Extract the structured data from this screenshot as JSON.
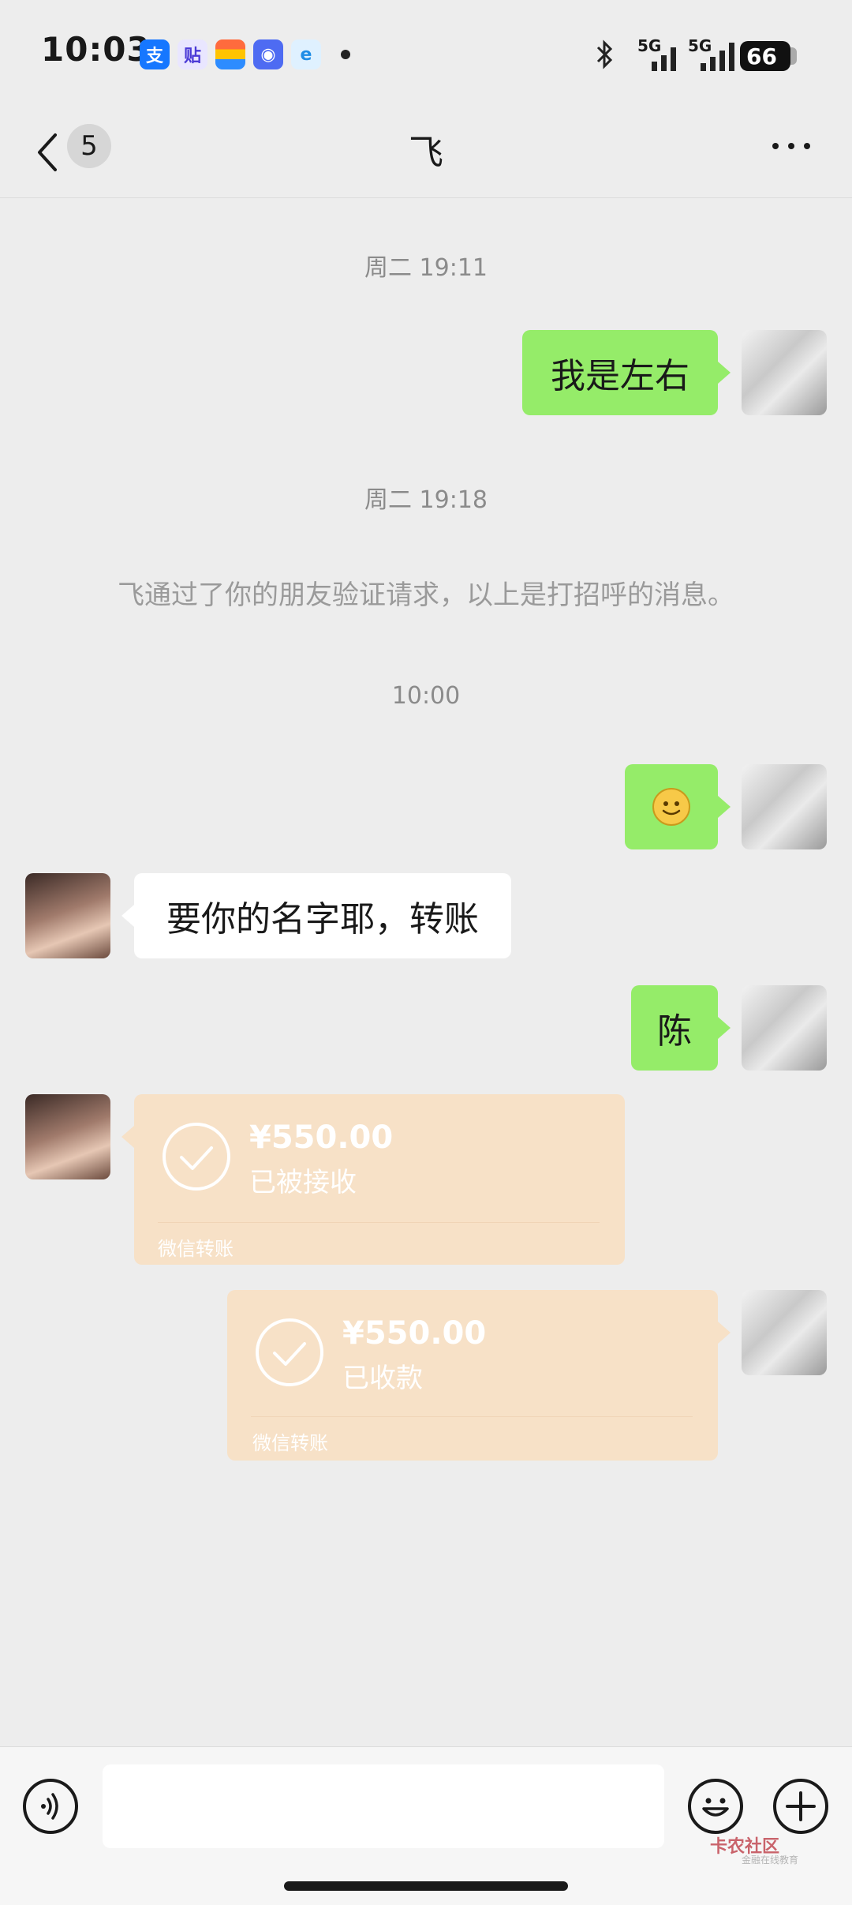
{
  "status_bar": {
    "time": "10:03",
    "notification_icons": [
      "alipay-icon",
      "tieba-icon",
      "wallet-icon",
      "chat-app-icon",
      "browser-icon"
    ],
    "network_1": "5G",
    "network_2": "5G",
    "battery": "66"
  },
  "nav": {
    "unread_count": "5",
    "title": "飞"
  },
  "messages": {
    "ts1": "周二 19:11",
    "m1": "我是左右",
    "ts2": "周二 19:18",
    "system": "飞通过了你的朋友验证请求，以上是打招呼的消息。",
    "ts3": "10:00",
    "m3": "要你的名字耶，转账",
    "m4": "陈",
    "transfer1": {
      "amount": "¥550.00",
      "status": "已被接收",
      "label": "微信转账"
    },
    "transfer2": {
      "amount": "¥550.00",
      "status": "已收款",
      "label": "微信转账"
    }
  },
  "watermark": {
    "title": "卡农社区",
    "sub": "金融在线教育"
  },
  "colors": {
    "background": "#ededed",
    "sent_bubble": "#95ec69",
    "received_bubble": "#ffffff",
    "transfer_card": "#f7e1c7"
  }
}
